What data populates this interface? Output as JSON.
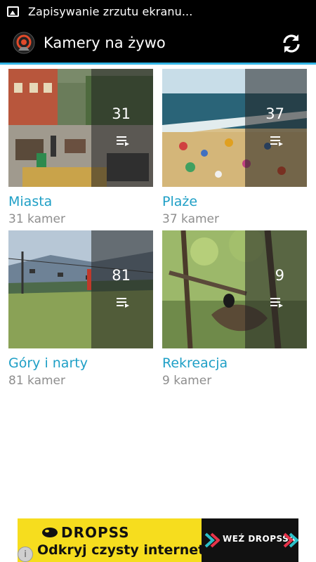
{
  "status_bar": {
    "notification_text": "Zapisywanie zrzutu ekranu..."
  },
  "action_bar": {
    "title": "Kamery na żywo"
  },
  "categories": [
    {
      "name": "Miasta",
      "count": "31",
      "subtitle": "31 kamer"
    },
    {
      "name": "Plaże",
      "count": "37",
      "subtitle": "37 kamer"
    },
    {
      "name": "Góry i narty",
      "count": "81",
      "subtitle": "81 kamer"
    },
    {
      "name": "Rekreacja",
      "count": "9",
      "subtitle": "9 kamer"
    }
  ],
  "ad": {
    "brand": "DROPSS",
    "tagline": "Odkryj czysty internet",
    "cta": "WEŹ DROPSSA",
    "info_icon": "i"
  },
  "colors": {
    "accent": "#33b5e5",
    "category_text": "#1e9fc6",
    "ad_background": "#f6dd1e"
  }
}
